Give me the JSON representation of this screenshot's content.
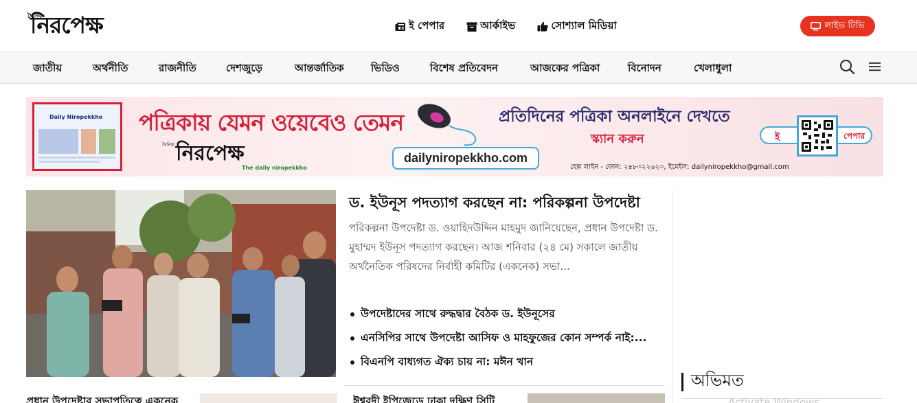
{
  "header": {
    "logo_small": "দৈনিক",
    "logo": "নিরপেক্ষ",
    "links": [
      {
        "label": "ই পেপার",
        "icon": "newspaper-icon"
      },
      {
        "label": "আর্কাইভ",
        "icon": "archive-box-icon"
      },
      {
        "label": "সোশ্যাল মিডিয়া",
        "icon": "thumbs-up-icon"
      }
    ],
    "live_tv": {
      "label": "লাইভ টিভি",
      "icon": "monitor-icon",
      "color": "#e6321e"
    }
  },
  "nav": {
    "items": [
      "জাতীয়",
      "অর্থনীতি",
      "রাজনীতি",
      "দেশজুড়ে",
      "আন্তর্জাতিক",
      "ভিডিও",
      "বিশেষ প্রতিবেদন",
      "আজকের পত্রিকা",
      "বিনোদন",
      "খেলাধুলা"
    ],
    "search_icon": "search-icon",
    "menu_icon": "hamburger-menu-icon"
  },
  "banner": {
    "thumb_title": "Daily Niropekkho",
    "slogan": "পত্রিকায় যেমন ওয়েবেও তেমন",
    "logo_small": "দৈনিক",
    "logo": "নিরপেক্ষ",
    "tagline": "The daily niropekkho",
    "url": "dailyniropekkho.com",
    "headline": "প্রতিদিনের পত্রিকা অনলাইনে দেখতে",
    "scan": "স্ক্যান করুন",
    "epaper_prefix": "ই",
    "epaper_suffix": "পেপার",
    "contact": "হেল্প লাইন - ফোন: ২৪৮৩২২৬২৩, ইমেইল: dailyniropekkho@gmail.com",
    "accent": "#d5203a"
  },
  "lead": {
    "title": "ড. ইউনূস পদত্যাগ করছেন না: পরিকল্পনা উপদেষ্টা",
    "summary": "পরিকল্পনা উপদেষ্টা ড. ওয়াহিদউদ্দিন মাহমুদ জানিয়েছেন, প্রধান উপদেষ্টা ড. মুহাম্মদ ইউনূস পদত্যাগ করছেন। আজ শনিবার (২৪ মে) সকালে জাতীয় অর্থনৈতিক পরিষদের নির্বাহী কমিটির (একনেক) সভা...",
    "related": [
      "উপদেষ্টাদের সাথে রুদ্ধদ্বার বৈঠক ড. ইউনূসের",
      "এনসিপির সাথে উপদেষ্টা আসিফ ও মাহফুজের কোন সম্পর্ক নাই:...",
      "বিএনপি বাধ্যগত ঐক্য চায় না: মঈন খান"
    ]
  },
  "bottom": {
    "title_1": "প্রধান উপদেষ্টার সভাপতিত্বে একনেক",
    "title_2": "ঈশ্বরদী ইপিজেডে ঢাকা দক্ষিণ সিটি"
  },
  "sidebar": {
    "opinion_heading": "অভিমত"
  },
  "watermark": "Activate Windows"
}
